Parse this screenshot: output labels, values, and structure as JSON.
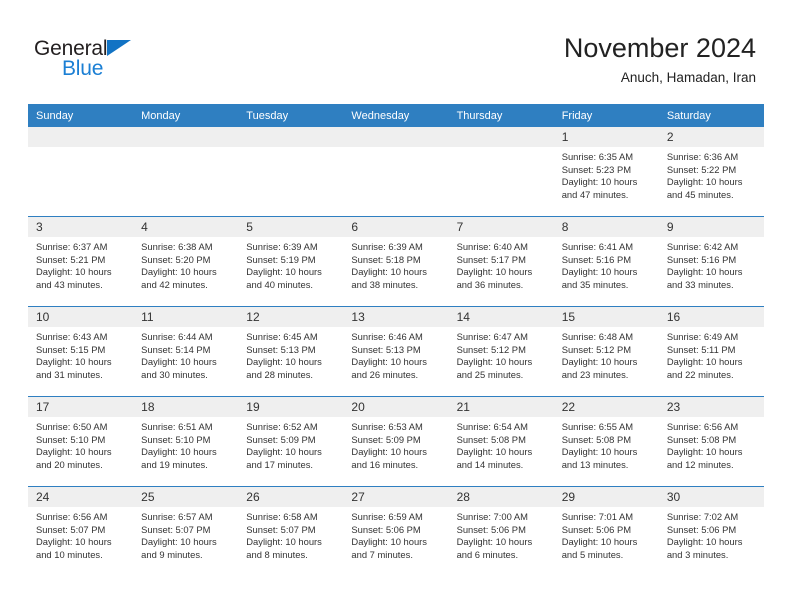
{
  "brand": {
    "name_part1": "General",
    "name_part2": "Blue",
    "triangle_color": "#1273c4",
    "blue_color": "#1b7fd4"
  },
  "header": {
    "title": "November 2024",
    "subtitle": "Anuch, Hamadan, Iran"
  },
  "theme": {
    "header_row_bg": "#2f7fc1",
    "daynum_bg": "#efefef",
    "border_color": "#2f7fc1",
    "text_color": "#333333"
  },
  "weekday_headers": [
    "Sunday",
    "Monday",
    "Tuesday",
    "Wednesday",
    "Thursday",
    "Friday",
    "Saturday"
  ],
  "weeks": [
    [
      {
        "day": "",
        "empty": true,
        "sunrise": "",
        "sunset": "",
        "daylight_line1": "",
        "daylight_line2": ""
      },
      {
        "day": "",
        "empty": true,
        "sunrise": "",
        "sunset": "",
        "daylight_line1": "",
        "daylight_line2": ""
      },
      {
        "day": "",
        "empty": true,
        "sunrise": "",
        "sunset": "",
        "daylight_line1": "",
        "daylight_line2": ""
      },
      {
        "day": "",
        "empty": true,
        "sunrise": "",
        "sunset": "",
        "daylight_line1": "",
        "daylight_line2": ""
      },
      {
        "day": "",
        "empty": true,
        "sunrise": "",
        "sunset": "",
        "daylight_line1": "",
        "daylight_line2": ""
      },
      {
        "day": "1",
        "empty": false,
        "sunrise": "Sunrise: 6:35 AM",
        "sunset": "Sunset: 5:23 PM",
        "daylight_line1": "Daylight: 10 hours",
        "daylight_line2": "and 47 minutes."
      },
      {
        "day": "2",
        "empty": false,
        "sunrise": "Sunrise: 6:36 AM",
        "sunset": "Sunset: 5:22 PM",
        "daylight_line1": "Daylight: 10 hours",
        "daylight_line2": "and 45 minutes."
      }
    ],
    [
      {
        "day": "3",
        "empty": false,
        "sunrise": "Sunrise: 6:37 AM",
        "sunset": "Sunset: 5:21 PM",
        "daylight_line1": "Daylight: 10 hours",
        "daylight_line2": "and 43 minutes."
      },
      {
        "day": "4",
        "empty": false,
        "sunrise": "Sunrise: 6:38 AM",
        "sunset": "Sunset: 5:20 PM",
        "daylight_line1": "Daylight: 10 hours",
        "daylight_line2": "and 42 minutes."
      },
      {
        "day": "5",
        "empty": false,
        "sunrise": "Sunrise: 6:39 AM",
        "sunset": "Sunset: 5:19 PM",
        "daylight_line1": "Daylight: 10 hours",
        "daylight_line2": "and 40 minutes."
      },
      {
        "day": "6",
        "empty": false,
        "sunrise": "Sunrise: 6:39 AM",
        "sunset": "Sunset: 5:18 PM",
        "daylight_line1": "Daylight: 10 hours",
        "daylight_line2": "and 38 minutes."
      },
      {
        "day": "7",
        "empty": false,
        "sunrise": "Sunrise: 6:40 AM",
        "sunset": "Sunset: 5:17 PM",
        "daylight_line1": "Daylight: 10 hours",
        "daylight_line2": "and 36 minutes."
      },
      {
        "day": "8",
        "empty": false,
        "sunrise": "Sunrise: 6:41 AM",
        "sunset": "Sunset: 5:16 PM",
        "daylight_line1": "Daylight: 10 hours",
        "daylight_line2": "and 35 minutes."
      },
      {
        "day": "9",
        "empty": false,
        "sunrise": "Sunrise: 6:42 AM",
        "sunset": "Sunset: 5:16 PM",
        "daylight_line1": "Daylight: 10 hours",
        "daylight_line2": "and 33 minutes."
      }
    ],
    [
      {
        "day": "10",
        "empty": false,
        "sunrise": "Sunrise: 6:43 AM",
        "sunset": "Sunset: 5:15 PM",
        "daylight_line1": "Daylight: 10 hours",
        "daylight_line2": "and 31 minutes."
      },
      {
        "day": "11",
        "empty": false,
        "sunrise": "Sunrise: 6:44 AM",
        "sunset": "Sunset: 5:14 PM",
        "daylight_line1": "Daylight: 10 hours",
        "daylight_line2": "and 30 minutes."
      },
      {
        "day": "12",
        "empty": false,
        "sunrise": "Sunrise: 6:45 AM",
        "sunset": "Sunset: 5:13 PM",
        "daylight_line1": "Daylight: 10 hours",
        "daylight_line2": "and 28 minutes."
      },
      {
        "day": "13",
        "empty": false,
        "sunrise": "Sunrise: 6:46 AM",
        "sunset": "Sunset: 5:13 PM",
        "daylight_line1": "Daylight: 10 hours",
        "daylight_line2": "and 26 minutes."
      },
      {
        "day": "14",
        "empty": false,
        "sunrise": "Sunrise: 6:47 AM",
        "sunset": "Sunset: 5:12 PM",
        "daylight_line1": "Daylight: 10 hours",
        "daylight_line2": "and 25 minutes."
      },
      {
        "day": "15",
        "empty": false,
        "sunrise": "Sunrise: 6:48 AM",
        "sunset": "Sunset: 5:12 PM",
        "daylight_line1": "Daylight: 10 hours",
        "daylight_line2": "and 23 minutes."
      },
      {
        "day": "16",
        "empty": false,
        "sunrise": "Sunrise: 6:49 AM",
        "sunset": "Sunset: 5:11 PM",
        "daylight_line1": "Daylight: 10 hours",
        "daylight_line2": "and 22 minutes."
      }
    ],
    [
      {
        "day": "17",
        "empty": false,
        "sunrise": "Sunrise: 6:50 AM",
        "sunset": "Sunset: 5:10 PM",
        "daylight_line1": "Daylight: 10 hours",
        "daylight_line2": "and 20 minutes."
      },
      {
        "day": "18",
        "empty": false,
        "sunrise": "Sunrise: 6:51 AM",
        "sunset": "Sunset: 5:10 PM",
        "daylight_line1": "Daylight: 10 hours",
        "daylight_line2": "and 19 minutes."
      },
      {
        "day": "19",
        "empty": false,
        "sunrise": "Sunrise: 6:52 AM",
        "sunset": "Sunset: 5:09 PM",
        "daylight_line1": "Daylight: 10 hours",
        "daylight_line2": "and 17 minutes."
      },
      {
        "day": "20",
        "empty": false,
        "sunrise": "Sunrise: 6:53 AM",
        "sunset": "Sunset: 5:09 PM",
        "daylight_line1": "Daylight: 10 hours",
        "daylight_line2": "and 16 minutes."
      },
      {
        "day": "21",
        "empty": false,
        "sunrise": "Sunrise: 6:54 AM",
        "sunset": "Sunset: 5:08 PM",
        "daylight_line1": "Daylight: 10 hours",
        "daylight_line2": "and 14 minutes."
      },
      {
        "day": "22",
        "empty": false,
        "sunrise": "Sunrise: 6:55 AM",
        "sunset": "Sunset: 5:08 PM",
        "daylight_line1": "Daylight: 10 hours",
        "daylight_line2": "and 13 minutes."
      },
      {
        "day": "23",
        "empty": false,
        "sunrise": "Sunrise: 6:56 AM",
        "sunset": "Sunset: 5:08 PM",
        "daylight_line1": "Daylight: 10 hours",
        "daylight_line2": "and 12 minutes."
      }
    ],
    [
      {
        "day": "24",
        "empty": false,
        "sunrise": "Sunrise: 6:56 AM",
        "sunset": "Sunset: 5:07 PM",
        "daylight_line1": "Daylight: 10 hours",
        "daylight_line2": "and 10 minutes."
      },
      {
        "day": "25",
        "empty": false,
        "sunrise": "Sunrise: 6:57 AM",
        "sunset": "Sunset: 5:07 PM",
        "daylight_line1": "Daylight: 10 hours",
        "daylight_line2": "and 9 minutes."
      },
      {
        "day": "26",
        "empty": false,
        "sunrise": "Sunrise: 6:58 AM",
        "sunset": "Sunset: 5:07 PM",
        "daylight_line1": "Daylight: 10 hours",
        "daylight_line2": "and 8 minutes."
      },
      {
        "day": "27",
        "empty": false,
        "sunrise": "Sunrise: 6:59 AM",
        "sunset": "Sunset: 5:06 PM",
        "daylight_line1": "Daylight: 10 hours",
        "daylight_line2": "and 7 minutes."
      },
      {
        "day": "28",
        "empty": false,
        "sunrise": "Sunrise: 7:00 AM",
        "sunset": "Sunset: 5:06 PM",
        "daylight_line1": "Daylight: 10 hours",
        "daylight_line2": "and 6 minutes."
      },
      {
        "day": "29",
        "empty": false,
        "sunrise": "Sunrise: 7:01 AM",
        "sunset": "Sunset: 5:06 PM",
        "daylight_line1": "Daylight: 10 hours",
        "daylight_line2": "and 5 minutes."
      },
      {
        "day": "30",
        "empty": false,
        "sunrise": "Sunrise: 7:02 AM",
        "sunset": "Sunset: 5:06 PM",
        "daylight_line1": "Daylight: 10 hours",
        "daylight_line2": "and 3 minutes."
      }
    ]
  ]
}
